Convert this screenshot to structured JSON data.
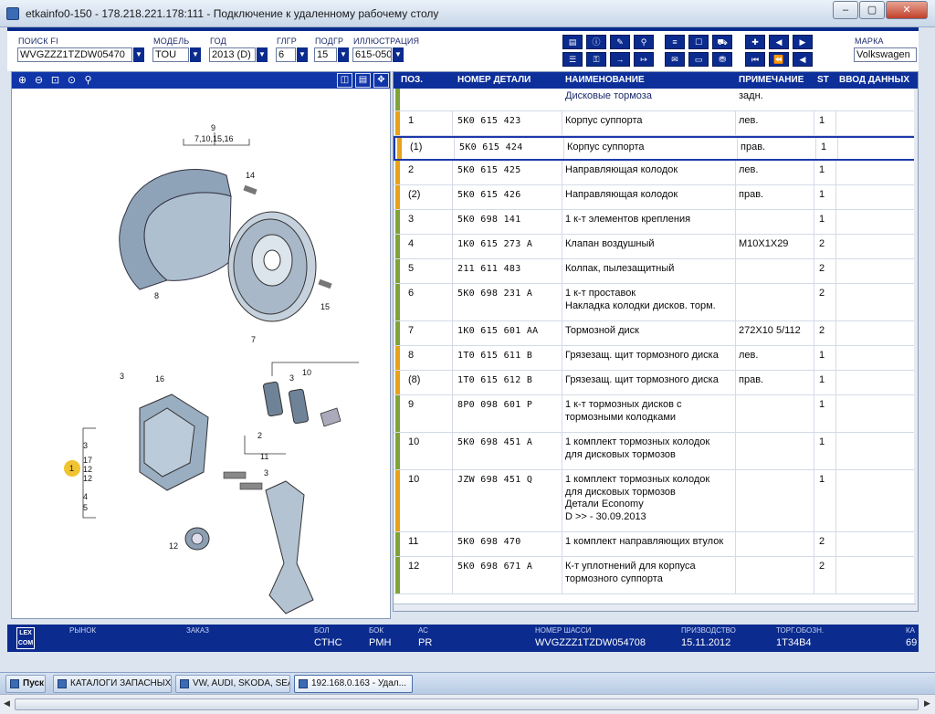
{
  "window": {
    "title": "etkainfo0-150 - 178.218.221.178:111 - Подключение к удаленному рабочему столу",
    "minimize": "–",
    "restore": "▢",
    "close": "✕"
  },
  "header": {
    "fields": [
      {
        "label": "ПОИСК FI",
        "value": "WVGZZZ1TZDW05470"
      },
      {
        "label": "МОДЕЛЬ",
        "value": "TOU"
      },
      {
        "label": "ГОД",
        "value": "2013 (D)"
      },
      {
        "label": "ГЛГР",
        "value": "6"
      },
      {
        "label": "ПОДГР",
        "value": "15"
      },
      {
        "label": "ИЛЛЮСТРАЦИЯ",
        "value": "615-050"
      }
    ],
    "brand_label": "МАРКА",
    "brand_value": "Volkswagen"
  },
  "illustration": {
    "callouts": [
      "9",
      "7,10,15,16",
      "14",
      "8",
      "15",
      "7",
      "3",
      "16",
      "3",
      "10",
      "2",
      "11",
      "3",
      "17",
      "1",
      "12",
      "4",
      "5",
      "12",
      "3",
      "12"
    ]
  },
  "table": {
    "columns": [
      "ПОЗ.",
      "НОМЕР ДЕТАЛИ",
      "НАИМЕНОВАНИЕ",
      "ПРИМЕЧАНИЕ",
      "ST",
      "ВВОД ДАННЫХ"
    ],
    "section_title": "Дисковые тормоза",
    "section_note": "задн.",
    "rows": [
      {
        "pos": "1",
        "part": "5K0  615  423",
        "name": "Корпус суппорта",
        "name2": "",
        "name3": "",
        "name4": "",
        "note": "лев.",
        "st": "1"
      },
      {
        "pos": "(1)",
        "part": "5K0  615  424",
        "name": "Корпус суппорта",
        "name2": "",
        "name3": "",
        "name4": "",
        "note": "прав.",
        "st": "1"
      },
      {
        "pos": "2",
        "part": "5K0  615  425",
        "name": "Направляющая колодок",
        "name2": "",
        "name3": "",
        "name4": "",
        "note": "лев.",
        "st": "1"
      },
      {
        "pos": "(2)",
        "part": "5K0  615  426",
        "name": "Направляющая колодок",
        "name2": "",
        "name3": "",
        "name4": "",
        "note": "прав.",
        "st": "1"
      },
      {
        "pos": "3",
        "part": "5K0  698  141",
        "name": "1 к-т элементов крепления",
        "name2": "",
        "name3": "",
        "name4": "",
        "note": "",
        "st": "1"
      },
      {
        "pos": "4",
        "part": "1K0  615  273  A",
        "name": "Клапан воздушный",
        "name2": "",
        "name3": "",
        "name4": "",
        "note": "M10X1X29",
        "st": "2"
      },
      {
        "pos": "5",
        "part": "211  611  483",
        "name": "Колпак, пылезащитный",
        "name2": "",
        "name3": "",
        "name4": "",
        "note": "",
        "st": "2"
      },
      {
        "pos": "6",
        "part": "5K0  698  231  A",
        "name": "1 к-т проставок",
        "name2": "Накладка колодки дисков. торм.",
        "name3": "",
        "name4": "",
        "note": "",
        "st": "2"
      },
      {
        "pos": "7",
        "part": "1K0  615  601  AA",
        "name": "Тормозной диск",
        "name2": "",
        "name3": "",
        "name4": "",
        "note": "272X10   5/112",
        "st": "2"
      },
      {
        "pos": "8",
        "part": "1T0  615  611  B",
        "name": "Грязезащ. щит тормозного диска",
        "name2": "",
        "name3": "",
        "name4": "",
        "note": "лев.",
        "st": "1"
      },
      {
        "pos": "(8)",
        "part": "1T0  615  612  B",
        "name": "Грязезащ. щит тормозного диска",
        "name2": "",
        "name3": "",
        "name4": "",
        "note": "прав.",
        "st": "1"
      },
      {
        "pos": "9",
        "part": "8P0  098  601  P",
        "name": "1 к-т тормозных дисков с",
        "name2": "тормозными колодками",
        "name3": "",
        "name4": "",
        "note": "",
        "st": "1"
      },
      {
        "pos": "10",
        "part": "5K0  698  451  A",
        "name": "1 комплект тормозных колодок",
        "name2": "для дисковых тормозов",
        "name3": "",
        "name4": "",
        "note": "",
        "st": "1"
      },
      {
        "pos": "10",
        "part": "JZW  698  451  Q",
        "name": "1 комплект тормозных колодок",
        "name2": "для дисковых тормозов",
        "name3": "Детали Economy",
        "name4": "D              >> - 30.09.2013",
        "note": "",
        "st": "1"
      },
      {
        "pos": "11",
        "part": "5K0  698  470",
        "name": "1 комплект направляющих втулок",
        "name2": "",
        "name3": "",
        "name4": "",
        "note": "",
        "st": "2"
      },
      {
        "pos": "12",
        "part": "5K0  698  671  A",
        "name": "К-т уплотнений для корпуса",
        "name2": "тормозного суппорта",
        "name3": "",
        "name4": "",
        "note": "",
        "st": "2"
      }
    ]
  },
  "status": {
    "items": [
      {
        "label": "РЫНОК",
        "value": ""
      },
      {
        "label": "ЗАКАЗ",
        "value": ""
      },
      {
        "label": "БОЛ",
        "value": "CTHC"
      },
      {
        "label": "БОК",
        "value": "PMH"
      },
      {
        "label": "АС",
        "value": "PR"
      },
      {
        "label": "НОМЕР ШАССИ",
        "value": "WVGZZZ1TZDW054708"
      },
      {
        "label": "ПРИЗВОДСТВО",
        "value": "15.11.2012"
      },
      {
        "label": "ТОРГ.ОБОЗН.",
        "value": "1T34B4"
      },
      {
        "label": "КА",
        "value": "69"
      }
    ],
    "logo": "LEX COM"
  },
  "taskbar": {
    "start": "Пуск",
    "tasks": [
      "КАТАЛОГИ ЗАПАСНЫХ ...",
      "VW, AUDI, SKODA, SEAT",
      "192.168.0.163 - Удал..."
    ]
  },
  "colors": {
    "header_blue": "#0d2f9a",
    "marker_green": "#7fa33a",
    "marker_orange": "#e6a21a"
  }
}
